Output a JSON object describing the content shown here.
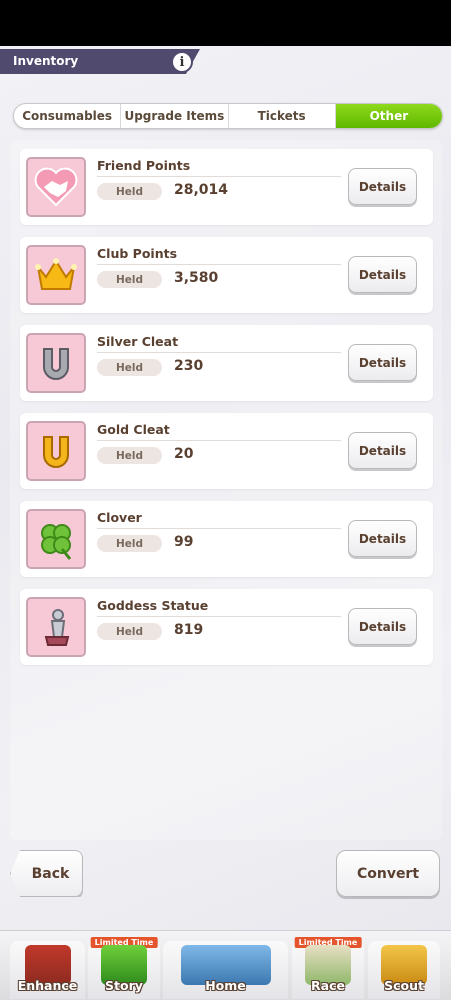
{
  "header": {
    "title": "Inventory",
    "info_symbol": "i"
  },
  "tabs": [
    {
      "label": "Consumables",
      "active": false
    },
    {
      "label": "Upgrade Items",
      "active": false
    },
    {
      "label": "Tickets",
      "active": false
    },
    {
      "label": "Other",
      "active": true
    }
  ],
  "items": [
    {
      "name": "Friend Points",
      "held_label": "Held",
      "held_value": "28,014",
      "details_label": "Details",
      "icon": "handshake-icon"
    },
    {
      "name": "Club Points",
      "held_label": "Held",
      "held_value": "3,580",
      "details_label": "Details",
      "icon": "crown-icon"
    },
    {
      "name": "Silver Cleat",
      "held_label": "Held",
      "held_value": "230",
      "details_label": "Details",
      "icon": "silver-horseshoe-icon"
    },
    {
      "name": "Gold Cleat",
      "held_label": "Held",
      "held_value": "20",
      "details_label": "Details",
      "icon": "gold-horseshoe-icon"
    },
    {
      "name": "Clover",
      "held_label": "Held",
      "held_value": "99",
      "details_label": "Details",
      "icon": "clover-icon"
    },
    {
      "name": "Goddess Statue",
      "held_label": "Held",
      "held_value": "819",
      "details_label": "Details",
      "icon": "goddess-statue-icon"
    }
  ],
  "footer": {
    "back_label": "Back",
    "convert_label": "Convert"
  },
  "bottom_nav": [
    {
      "label": "Enhance",
      "badge": ""
    },
    {
      "label": "Story",
      "badge": "Limited Time"
    },
    {
      "label": "Home",
      "badge": ""
    },
    {
      "label": "Race",
      "badge": "Limited Time"
    },
    {
      "label": "Scout",
      "badge": ""
    }
  ],
  "colors": {
    "active_tab": "#6cc40a",
    "header_bg": "#4f4a6e",
    "icon_bg": "#f7c9d6",
    "text_brown": "#5a4030"
  }
}
